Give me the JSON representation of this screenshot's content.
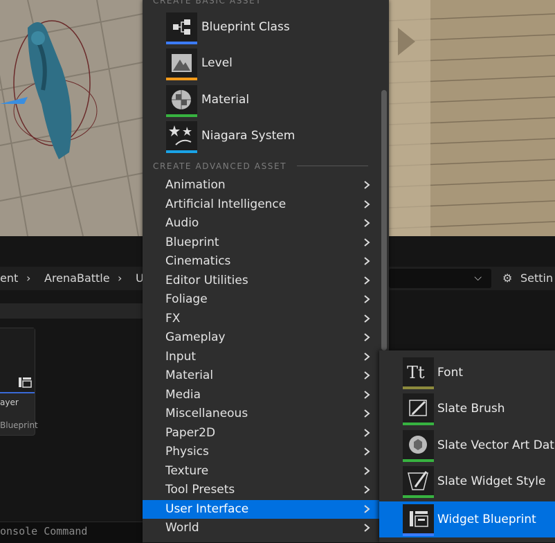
{
  "breadcrumb": {
    "items": [
      "ent",
      "ArenaBattle",
      "U"
    ]
  },
  "toolbar": {
    "settings_label": "Settin"
  },
  "asset_card": {
    "name_partial": "ayer",
    "type_partial": "Blueprint"
  },
  "console": {
    "placeholder": "onsole Command"
  },
  "menu": {
    "basic_header": "CREATE BASIC ASSET",
    "basic_items": [
      {
        "label": "Blueprint Class",
        "icon": "blueprint-class-icon",
        "color": "#3b7bff"
      },
      {
        "label": "Level",
        "icon": "level-icon",
        "color": "#f29a1a"
      },
      {
        "label": "Material",
        "icon": "material-icon",
        "color": "#37b240"
      },
      {
        "label": "Niagara System",
        "icon": "niagara-system-icon",
        "color": "#1aa3e6"
      }
    ],
    "advanced_header": "CREATE ADVANCED ASSET",
    "advanced_items": [
      {
        "label": "Animation"
      },
      {
        "label": "Artificial Intelligence"
      },
      {
        "label": "Audio"
      },
      {
        "label": "Blueprint"
      },
      {
        "label": "Cinematics"
      },
      {
        "label": "Editor Utilities"
      },
      {
        "label": "Foliage"
      },
      {
        "label": "FX"
      },
      {
        "label": "Gameplay"
      },
      {
        "label": "Input"
      },
      {
        "label": "Material"
      },
      {
        "label": "Media"
      },
      {
        "label": "Miscellaneous"
      },
      {
        "label": "Paper2D"
      },
      {
        "label": "Physics"
      },
      {
        "label": "Texture"
      },
      {
        "label": "Tool Presets"
      },
      {
        "label": "User Interface",
        "selected": true
      },
      {
        "label": "World"
      }
    ]
  },
  "submenu": {
    "items": [
      {
        "label": "Font",
        "icon": "font-icon",
        "color": "#8c8a3c"
      },
      {
        "label": "Slate Brush",
        "icon": "slate-brush-icon",
        "color": "#37b240"
      },
      {
        "label": "Slate Vector Art Data",
        "icon": "slate-vector-art-icon",
        "color": "#37b240"
      },
      {
        "label": "Slate Widget Style",
        "icon": "slate-widget-style-icon",
        "color": "#37b240"
      },
      {
        "label": "Widget Blueprint",
        "icon": "widget-blueprint-icon",
        "color": "#3b7bff",
        "selected": true
      }
    ]
  },
  "colors": {
    "selection": "#0070e0",
    "menu_bg": "#2e2e2e"
  }
}
